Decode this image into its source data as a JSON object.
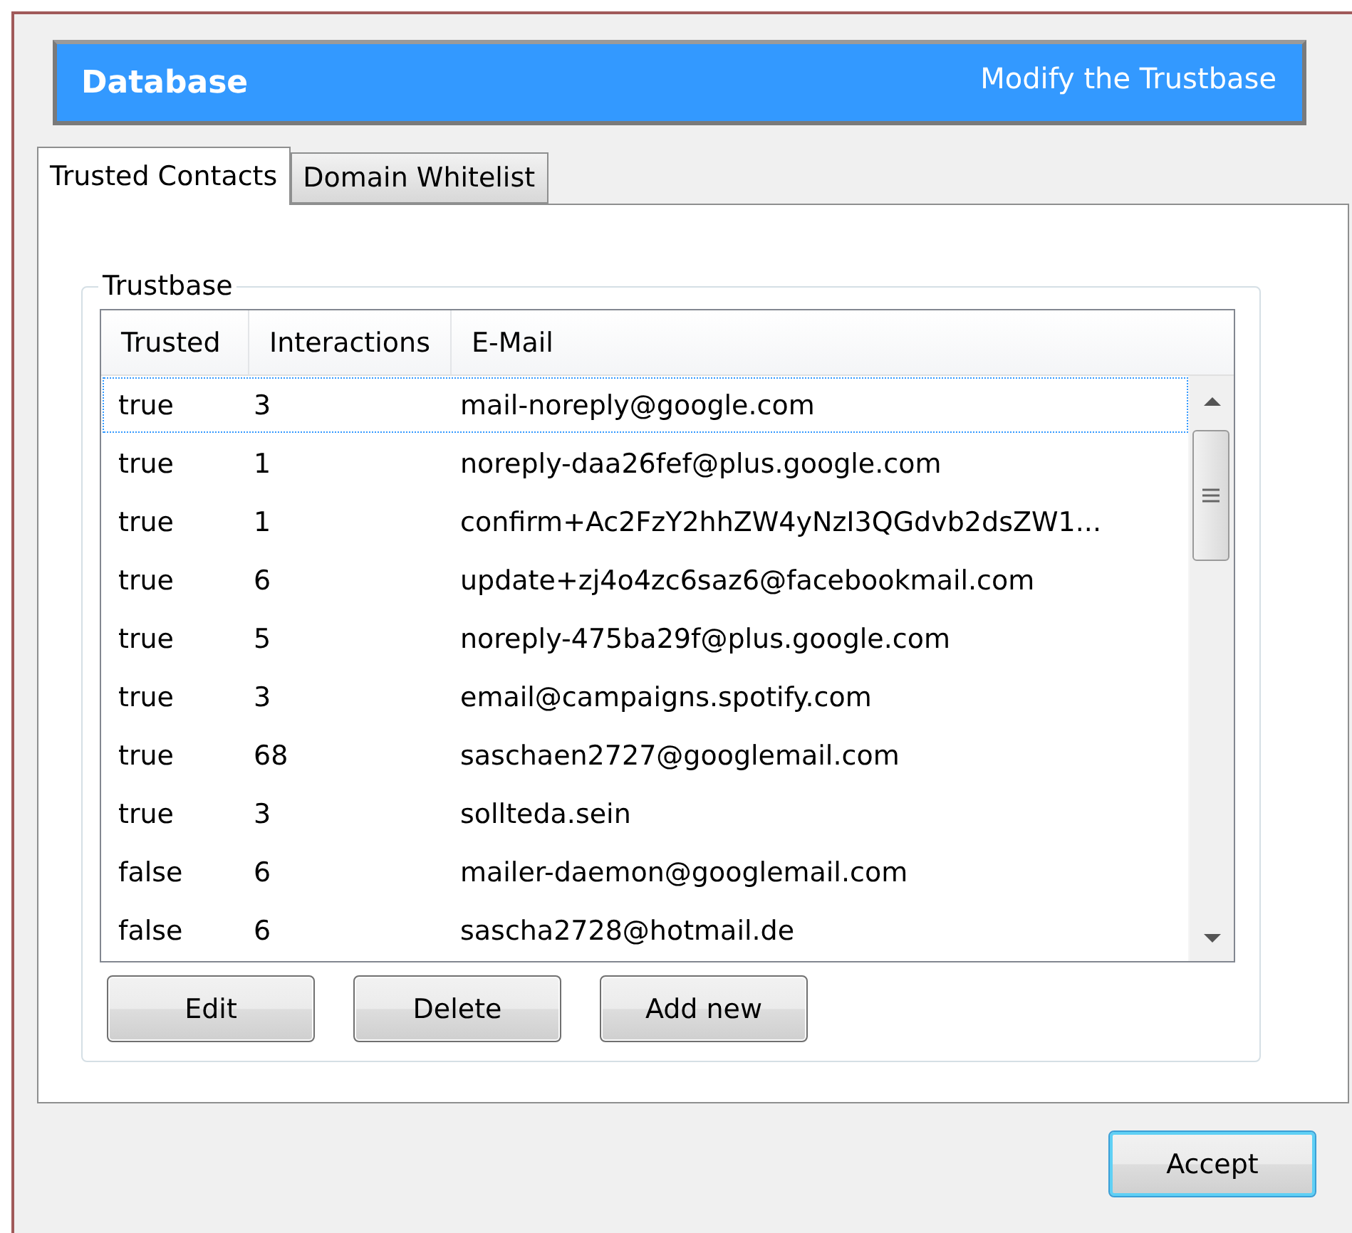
{
  "header": {
    "title": "Database",
    "subtitle": "Modify the Trustbase"
  },
  "tabs": [
    {
      "label": "Trusted Contacts",
      "selected": true
    },
    {
      "label": "Domain Whitelist",
      "selected": false
    }
  ],
  "group": {
    "title": "Trustbase"
  },
  "table": {
    "columns": [
      "Trusted",
      "Interactions",
      "E-Mail"
    ],
    "rows": [
      {
        "trusted": "true",
        "interactions": "3",
        "email": "mail-noreply@google.com",
        "selected": true
      },
      {
        "trusted": "true",
        "interactions": "1",
        "email": "noreply-daa26fef@plus.google.com",
        "selected": false
      },
      {
        "trusted": "true",
        "interactions": "1",
        "email": "confirm+Ac2FzY2hhZW4yNzI3QGdvb2dsZW1...",
        "selected": false
      },
      {
        "trusted": "true",
        "interactions": "6",
        "email": "update+zj4o4zc6saz6@facebookmail.com",
        "selected": false
      },
      {
        "trusted": "true",
        "interactions": "5",
        "email": "noreply-475ba29f@plus.google.com",
        "selected": false
      },
      {
        "trusted": "true",
        "interactions": "3",
        "email": "email@campaigns.spotify.com",
        "selected": false
      },
      {
        "trusted": "true",
        "interactions": "68",
        "email": "saschaen2727@googlemail.com",
        "selected": false
      },
      {
        "trusted": "true",
        "interactions": "3",
        "email": "sollteda.sein",
        "selected": false
      },
      {
        "trusted": "false",
        "interactions": "6",
        "email": "mailer-daemon@googlemail.com",
        "selected": false
      },
      {
        "trusted": "false",
        "interactions": "6",
        "email": "sascha2728@hotmail.de",
        "selected": false
      }
    ]
  },
  "table_buttons": [
    "Edit",
    "Delete",
    "Add new"
  ],
  "accept_button": "Accept"
}
